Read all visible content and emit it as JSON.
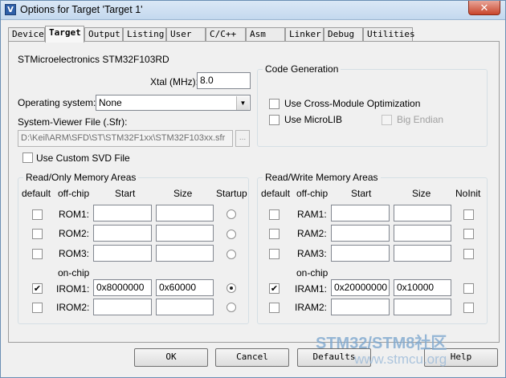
{
  "window": {
    "title": "Options for Target 'Target 1'",
    "icon": "keil-icon",
    "close_glyph": "✕"
  },
  "tabs": [
    "Device",
    "Target",
    "Output",
    "Listing",
    "User",
    "C/C++",
    "Asm",
    "Linker",
    "Debug",
    "Utilities"
  ],
  "active_tab": "Target",
  "device_name": "STMicroelectronics STM32F103RD",
  "xtal": {
    "label": "Xtal (MHz):",
    "value": "8.0"
  },
  "os": {
    "label": "Operating system:",
    "value": "None"
  },
  "svd": {
    "label": "System-Viewer File (.Sfr):",
    "value": "D:\\Keil\\ARM\\SFD\\ST\\STM32F1xx\\STM32F103xx.sfr",
    "browse": "...",
    "custom_label": "Use Custom SVD File"
  },
  "codegen": {
    "title": "Code Generation",
    "cross_module": "Use Cross-Module Optimization",
    "microlib": "Use MicroLIB",
    "big_endian": "Big Endian"
  },
  "rom": {
    "title": "Read/Only Memory Areas",
    "headers": {
      "default": "default",
      "offchip": "off-chip",
      "start": "Start",
      "size": "Size",
      "extra": "Startup"
    },
    "onchip_label": "on-chip",
    "rows": [
      {
        "label": "ROM1:",
        "start": "",
        "size": "",
        "default": false,
        "flag": false
      },
      {
        "label": "ROM2:",
        "start": "",
        "size": "",
        "default": false,
        "flag": false
      },
      {
        "label": "ROM3:",
        "start": "",
        "size": "",
        "default": false,
        "flag": false
      },
      {
        "label": "IROM1:",
        "start": "0x8000000",
        "size": "0x60000",
        "default": true,
        "flag": true
      },
      {
        "label": "IROM2:",
        "start": "",
        "size": "",
        "default": false,
        "flag": false
      }
    ]
  },
  "ram": {
    "title": "Read/Write Memory Areas",
    "headers": {
      "default": "default",
      "offchip": "off-chip",
      "start": "Start",
      "size": "Size",
      "extra": "NoInit"
    },
    "onchip_label": "on-chip",
    "rows": [
      {
        "label": "RAM1:",
        "start": "",
        "size": "",
        "default": false,
        "flag": false
      },
      {
        "label": "RAM2:",
        "start": "",
        "size": "",
        "default": false,
        "flag": false
      },
      {
        "label": "RAM3:",
        "start": "",
        "size": "",
        "default": false,
        "flag": false
      },
      {
        "label": "IRAM1:",
        "start": "0x20000000",
        "size": "0x10000",
        "default": true,
        "flag": false
      },
      {
        "label": "IRAM2:",
        "start": "",
        "size": "",
        "default": false,
        "flag": false
      }
    ]
  },
  "buttons": {
    "ok": "OK",
    "cancel": "Cancel",
    "defaults": "Defaults",
    "help": "Help"
  },
  "watermark": {
    "line1": "STM32/STM8社区",
    "line2": "www.stmcu.org"
  },
  "colors": {
    "titlebar": "#c3d8ee",
    "close": "#c9462c",
    "group_border": "#d5dfe5"
  }
}
